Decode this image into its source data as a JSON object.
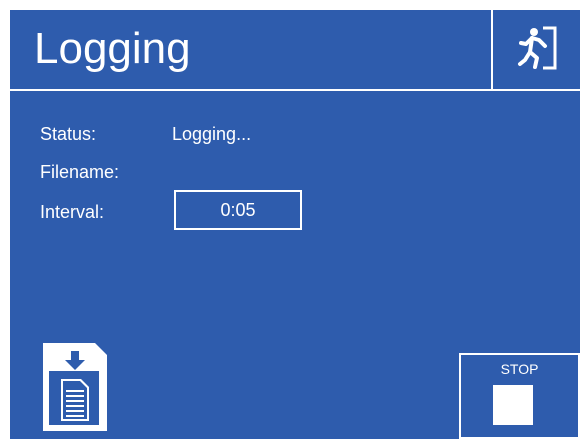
{
  "header": {
    "title": "Logging",
    "exit_icon": "emergency-exit-icon"
  },
  "fields": {
    "status_label": "Status:",
    "status_value": "Logging...",
    "filename_label": "Filename:",
    "filename_value": "",
    "interval_label": "Interval:",
    "interval_value": "0:05"
  },
  "controls": {
    "sd_card_icon": "sd-card-save-icon",
    "stop_label": "STOP"
  },
  "colors": {
    "background": "#2e5cad",
    "foreground": "#ffffff"
  }
}
